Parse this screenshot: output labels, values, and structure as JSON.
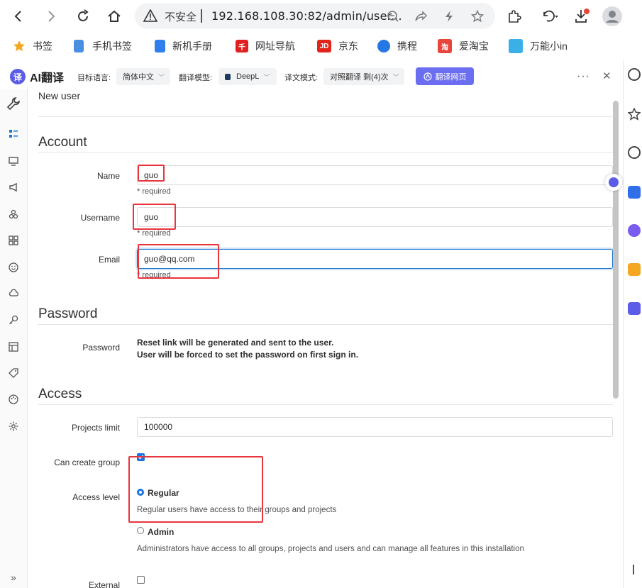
{
  "browser": {
    "security_label": "不安全",
    "url": "192.168.108.30:82/admin/user..."
  },
  "bookmarks": [
    {
      "label": "书签",
      "icon": "star-icon",
      "color": "#f5a623"
    },
    {
      "label": "手机书签",
      "icon": "phone-icon",
      "color": "#4a90e2"
    },
    {
      "label": "新机手册",
      "icon": "manual-icon",
      "color": "#2f80ed"
    },
    {
      "label": "网址导航",
      "icon": "navigation-icon",
      "color": "#e02020"
    },
    {
      "label": "京东",
      "icon": "jd-icon",
      "color": "#e1251b"
    },
    {
      "label": "携程",
      "icon": "ctrip-icon",
      "color": "#2577e3"
    },
    {
      "label": "爱淘宝",
      "icon": "taobao-icon",
      "color": "#e8453c"
    },
    {
      "label": "万能小in",
      "icon": "wanneng-icon",
      "color": "#3bb0e8"
    }
  ],
  "translate_bar": {
    "brand": "AI翻译",
    "logo_char": "译",
    "target_lang_label": "目标语言:",
    "target_lang_value": "简体中文",
    "model_label": "翻译模型:",
    "model_value": "DeepL",
    "mode_label": "译文模式:",
    "mode_value": "对照翻译 剩(4)次",
    "translate_button": "翻译网页"
  },
  "page": {
    "title": "New user",
    "sections": {
      "account": "Account",
      "password": "Password",
      "access": "Access"
    },
    "fields": {
      "name": {
        "label": "Name",
        "value": "guo",
        "help": "* required"
      },
      "username": {
        "label": "Username",
        "value": "guo",
        "help": "* required"
      },
      "email": {
        "label": "Email",
        "value": "guo@qq.com",
        "help": "* required"
      }
    },
    "password": {
      "label": "Password",
      "line1": "Reset link will be generated and sent to the user.",
      "line2": "User will be forced to set the password on first sign in."
    },
    "access": {
      "projects_limit_label": "Projects limit",
      "projects_limit_value": "100000",
      "can_create_group_label": "Can create group",
      "can_create_group_checked": true,
      "access_level_label": "Access level",
      "regular_label": "Regular",
      "regular_desc": "Regular users have access to their groups and projects",
      "admin_label": "Admin",
      "admin_desc": "Administrators have access to all groups, projects and users and can manage all features in this installation",
      "selected_level": "Regular",
      "external_label": "External",
      "external_checked": false
    }
  },
  "accent_color": "#1f78d1",
  "annotation_color": "#e8353d"
}
